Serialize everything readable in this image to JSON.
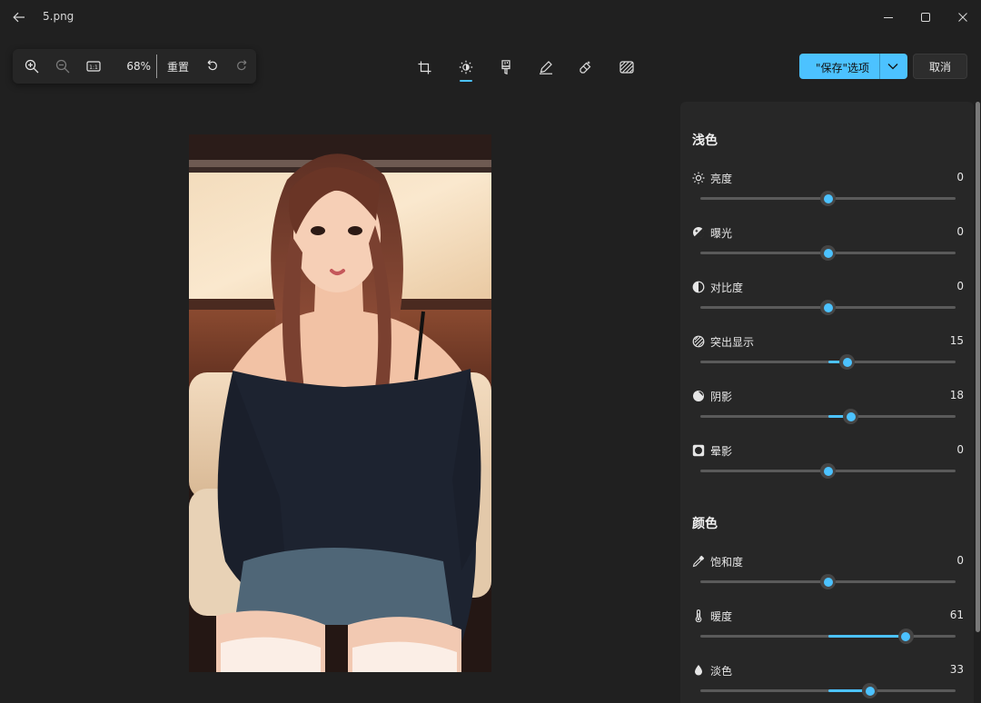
{
  "window": {
    "title": "5.png"
  },
  "zoom": {
    "level": "68%",
    "reset_label": "重置"
  },
  "actions": {
    "save_label": "\"保存\"选项",
    "cancel_label": "取消"
  },
  "colors": {
    "accent": "#4cc2ff",
    "background": "#202020",
    "panel": "#272727"
  },
  "editor_tools": [
    "crop-icon",
    "adjust-icon",
    "filter-icon",
    "markup-icon",
    "erase-icon",
    "background-blur-icon"
  ],
  "adjustments": {
    "light": {
      "title": "浅色",
      "items": [
        {
          "key": "brightness",
          "label": "亮度",
          "value": "0",
          "icon": "brightness-icon",
          "min": -100,
          "max": 100
        },
        {
          "key": "exposure",
          "label": "曝光",
          "value": "0",
          "icon": "exposure-icon",
          "min": -100,
          "max": 100
        },
        {
          "key": "contrast",
          "label": "对比度",
          "value": "0",
          "icon": "contrast-icon",
          "min": -100,
          "max": 100
        },
        {
          "key": "highlights",
          "label": "突出显示",
          "value": "15",
          "icon": "highlights-icon",
          "min": -100,
          "max": 100
        },
        {
          "key": "shadows",
          "label": "阴影",
          "value": "18",
          "icon": "shadows-icon",
          "min": -100,
          "max": 100
        },
        {
          "key": "vignette",
          "label": "晕影",
          "value": "0",
          "icon": "vignette-icon",
          "min": -100,
          "max": 100
        }
      ]
    },
    "color": {
      "title": "颜色",
      "items": [
        {
          "key": "saturation",
          "label": "饱和度",
          "value": "0",
          "icon": "saturation-icon",
          "min": -100,
          "max": 100
        },
        {
          "key": "warmth",
          "label": "暖度",
          "value": "61",
          "icon": "warmth-icon",
          "min": -100,
          "max": 100
        },
        {
          "key": "tint",
          "label": "淡色",
          "value": "33",
          "icon": "tint-icon",
          "min": -100,
          "max": 100
        }
      ]
    }
  }
}
